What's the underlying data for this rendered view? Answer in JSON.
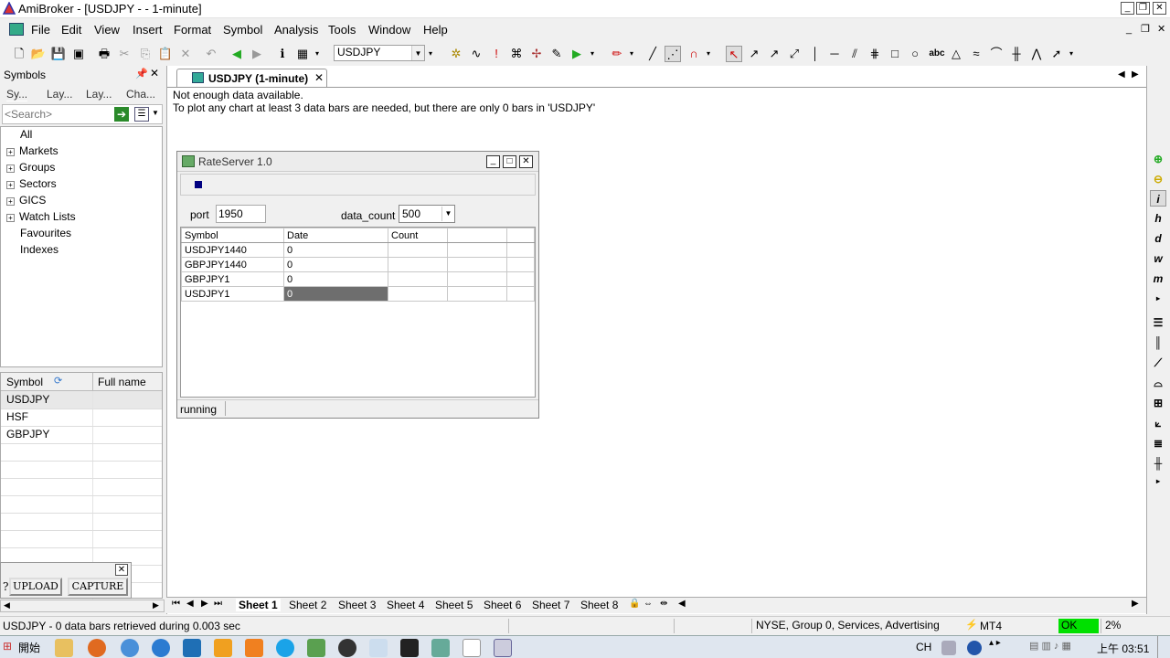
{
  "window": {
    "title": "AmiBroker - [USDJPY - - 1-minute]"
  },
  "menu": {
    "items": [
      "File",
      "Edit",
      "View",
      "Insert",
      "Format",
      "Symbol",
      "Analysis",
      "Tools",
      "Window",
      "Help"
    ]
  },
  "toolbar": {
    "symbol_combo": "USDJPY"
  },
  "symbols_panel": {
    "title": "Symbols",
    "tabs": [
      "Sy...",
      "Lay...",
      "Lay...",
      "Cha..."
    ],
    "search_placeholder": "<Search>",
    "tree": [
      "All",
      "Markets",
      "Groups",
      "Sectors",
      "GICS",
      "Watch Lists",
      "Favourites",
      "Indexes"
    ],
    "list_headers": {
      "symbol": "Symbol",
      "full_name": "Full name"
    },
    "list": [
      "USDJPY",
      "HSF",
      "GBPJPY"
    ]
  },
  "upload_capture": {
    "help": "?",
    "upload": "UPLOAD",
    "capture": "CAPTURE"
  },
  "doc": {
    "tab_title": "USDJPY (1-minute)",
    "msg1": "Not enough data available.",
    "msg2": "To plot any chart at least 3 data bars are needed, but there are only 0 bars in 'USDJPY'"
  },
  "rateserver": {
    "title": "RateServer 1.0",
    "port_label": "port",
    "port_value": "1950",
    "data_count_label": "data_count",
    "data_count_value": "500",
    "headers": [
      "Symbol",
      "Date",
      "Count",
      ""
    ],
    "rows": [
      {
        "symbol": "USDJPY1440",
        "date": "0",
        "count": ""
      },
      {
        "symbol": "GBPJPY1440",
        "date": "0",
        "count": ""
      },
      {
        "symbol": "GBPJPY1",
        "date": "0",
        "count": ""
      },
      {
        "symbol": "USDJPY1",
        "date": "0",
        "count": ""
      }
    ],
    "status": "running"
  },
  "sheets": [
    "Sheet 1",
    "Sheet 2",
    "Sheet 3",
    "Sheet 4",
    "Sheet 5",
    "Sheet 6",
    "Sheet 7",
    "Sheet 8"
  ],
  "statusbar": {
    "message": "USDJPY - 0 data bars retrieved during 0.003 sec",
    "info": "NYSE, Group 0, Services, Advertising",
    "plugin": "MT4",
    "ok": "OK",
    "pct": "2%"
  },
  "taskbar": {
    "start": "開始",
    "lang": "CH",
    "time": "上午 03:51"
  },
  "colors": {
    "ok_green": "#00e000",
    "selection_grey": "#6e6e6e",
    "accent_blue": "#000080"
  }
}
